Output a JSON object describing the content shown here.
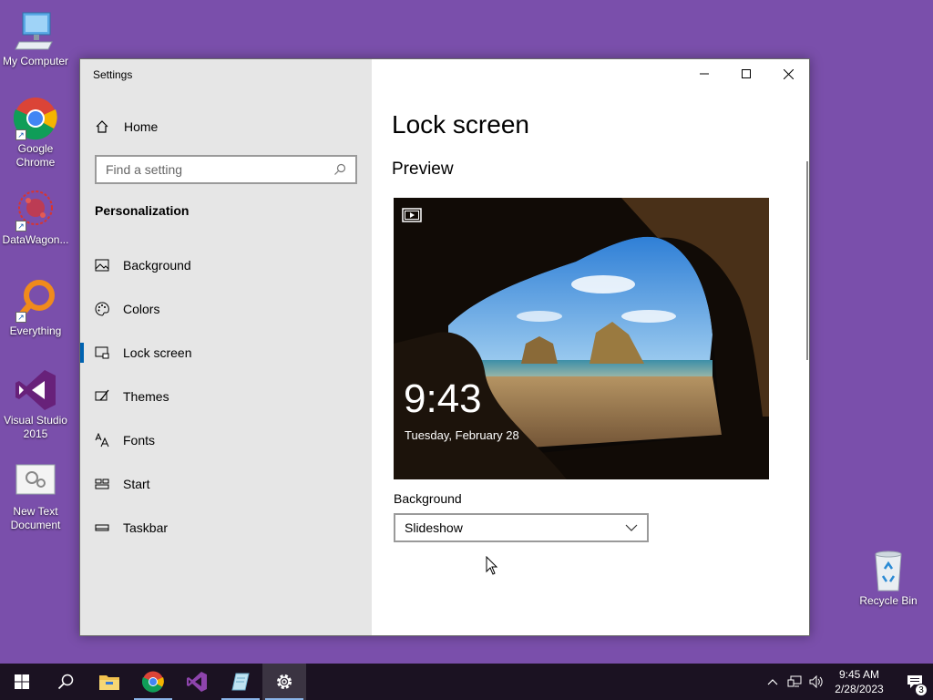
{
  "desktop": {
    "icons": [
      {
        "label": "My Computer",
        "icon": "computer-icon"
      },
      {
        "label": "Google Chrome",
        "icon": "chrome-icon"
      },
      {
        "label": "DataWagon...",
        "icon": "datawagon-icon"
      },
      {
        "label": "Everything",
        "icon": "everything-search-icon"
      },
      {
        "label": "Visual Studio 2015",
        "icon": "visual-studio-icon"
      },
      {
        "label": "New Text Document",
        "icon": "text-document-icon"
      },
      {
        "label": "Recycle Bin",
        "icon": "recycle-bin-icon"
      }
    ]
  },
  "window": {
    "title": "Settings",
    "controls": {
      "minimize": "minimize-icon",
      "maximize": "maximize-icon",
      "close": "close-icon"
    }
  },
  "sidebar": {
    "home_label": "Home",
    "search_placeholder": "Find a setting",
    "section_title": "Personalization",
    "items": [
      {
        "label": "Background",
        "icon": "picture-icon"
      },
      {
        "label": "Colors",
        "icon": "palette-icon"
      },
      {
        "label": "Lock screen",
        "icon": "lock-screen-icon",
        "active": true
      },
      {
        "label": "Themes",
        "icon": "brush-icon"
      },
      {
        "label": "Fonts",
        "icon": "font-icon"
      },
      {
        "label": "Start",
        "icon": "start-grid-icon"
      },
      {
        "label": "Taskbar",
        "icon": "taskbar-icon"
      }
    ]
  },
  "main": {
    "title": "Lock screen",
    "preview_heading": "Preview",
    "preview": {
      "time": "9:43",
      "date": "Tuesday, February 28"
    },
    "background_label": "Background",
    "background_value": "Slideshow"
  },
  "taskbar": {
    "apps": [
      "start-icon",
      "search-icon",
      "file-explorer-icon",
      "chrome-icon",
      "visual-studio-icon",
      "notepad-icon",
      "settings-gear-icon"
    ],
    "clock": {
      "time": "9:45 AM",
      "date": "2/28/2023"
    },
    "notification_count": "3"
  },
  "colors": {
    "desktop": "#7a4fab",
    "accent": "#0063b1",
    "taskbar": "#1b1222"
  }
}
